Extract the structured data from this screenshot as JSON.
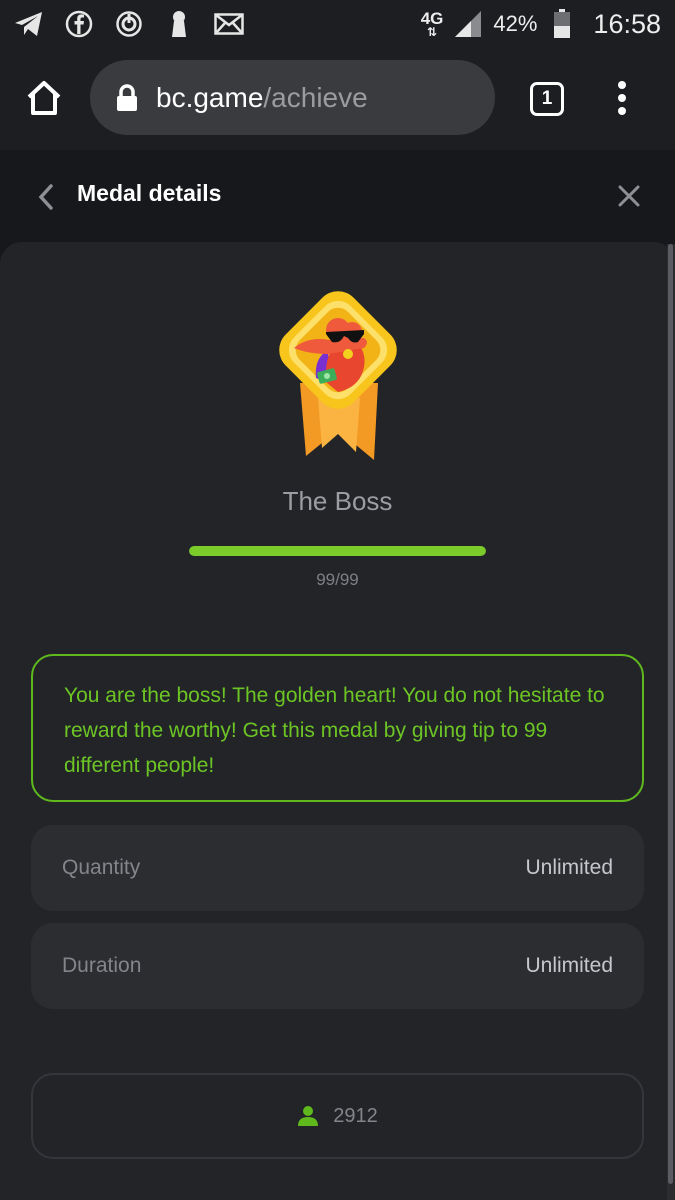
{
  "status_bar": {
    "icons": [
      "telegram-icon",
      "facebook-icon",
      "sync-icon",
      "keyhole-icon",
      "mail-icon"
    ],
    "network_type": "4G",
    "battery_percent": "42%",
    "time": "16:58"
  },
  "browser": {
    "url_host": "bc.game",
    "url_path": "/achieve",
    "tab_count": "1"
  },
  "page": {
    "title": "Medal details"
  },
  "medal": {
    "name": "The Boss",
    "progress_text": "99/99",
    "progress_fraction": 1.0,
    "description": "You are the boss! The golden heart! You do not hesitate to reward the worthy! Get this medal by giving tip to 99 different people!",
    "quantity_label": "Quantity",
    "quantity_value": "Unlimited",
    "duration_label": "Duration",
    "duration_value": "Unlimited",
    "holders_count": "2912"
  },
  "colors": {
    "accent_green": "#6cc524",
    "background": "#17181b",
    "panel": "#222428"
  }
}
